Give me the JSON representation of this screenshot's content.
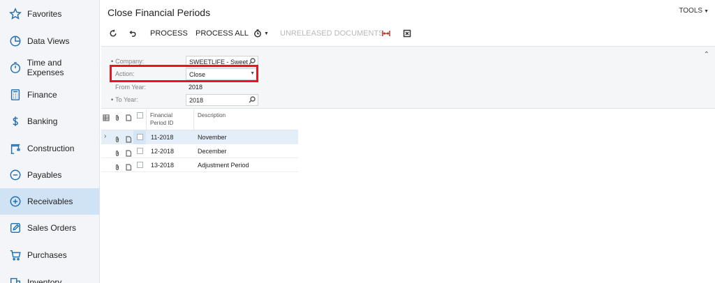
{
  "sidebar": {
    "items": [
      {
        "label": "Favorites",
        "icon": "star-icon",
        "active": false
      },
      {
        "label": "Data Views",
        "icon": "pie-chart-icon",
        "active": false
      },
      {
        "label": "Time and Expenses",
        "icon": "stopwatch-icon",
        "active": false
      },
      {
        "label": "Finance",
        "icon": "calculator-icon",
        "active": false
      },
      {
        "label": "Banking",
        "icon": "dollar-icon",
        "active": false
      },
      {
        "label": "Construction",
        "icon": "crane-icon",
        "active": false
      },
      {
        "label": "Payables",
        "icon": "minus-circle-icon",
        "active": false
      },
      {
        "label": "Receivables",
        "icon": "plus-circle-icon",
        "active": true
      },
      {
        "label": "Sales Orders",
        "icon": "edit-icon",
        "active": false
      },
      {
        "label": "Purchases",
        "icon": "cart-icon",
        "active": false
      },
      {
        "label": "Inventory",
        "icon": "box-icon",
        "active": false
      }
    ]
  },
  "header": {
    "title": "Close Financial Periods",
    "tools_label": "TOOLS"
  },
  "toolbar": {
    "process_label": "PROCESS",
    "process_all_label": "PROCESS ALL",
    "unreleased_label": "UNRELEASED DOCUMENTS"
  },
  "form": {
    "company_label": "Company:",
    "company_value": "SWEETLIFE - Sweet",
    "action_label": "Action:",
    "action_value": "Close",
    "from_year_label": "From Year:",
    "from_year_value": "2018",
    "to_year_label": "To Year:",
    "to_year_value": "2018"
  },
  "grid": {
    "columns": {
      "period_id_line1": "Financial",
      "period_id_line2": "Period ID",
      "description": "Description"
    },
    "rows": [
      {
        "period_id": "11-2018",
        "description": "November"
      },
      {
        "period_id": "12-2018",
        "description": "December"
      },
      {
        "period_id": "13-2018",
        "description": "Adjustment Period"
      }
    ]
  },
  "colors": {
    "accent": "#1f6fb2",
    "highlight_border": "#e8141f",
    "active_nav": "#cfe3f5"
  }
}
